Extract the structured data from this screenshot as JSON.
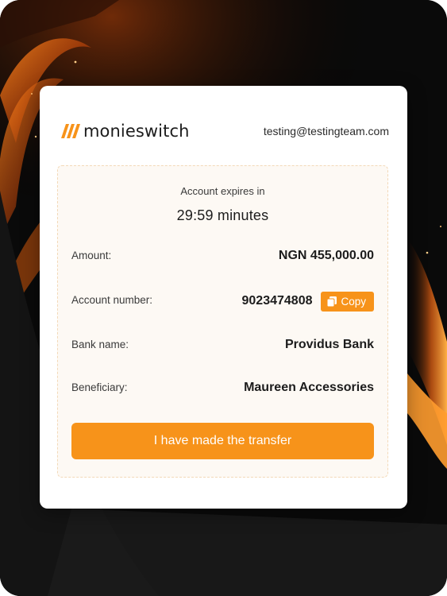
{
  "brand": {
    "name": "monieswitch",
    "accent_color": "#f7931a"
  },
  "header": {
    "email": "testing@testingteam.com"
  },
  "payment": {
    "expires_label": "Account expires in",
    "timer": "29:59 minutes",
    "rows": [
      {
        "label": "Amount:",
        "value": "NGN 455,000.00"
      },
      {
        "label": "Account number:",
        "value": "9023474808"
      },
      {
        "label": "Bank name:",
        "value": "Providus Bank"
      },
      {
        "label": "Beneficiary:",
        "value": "Maureen Accessories"
      }
    ],
    "copy_label": "Copy",
    "copy_icon": "copy-icon",
    "submit_label": "I have made the transfer"
  }
}
